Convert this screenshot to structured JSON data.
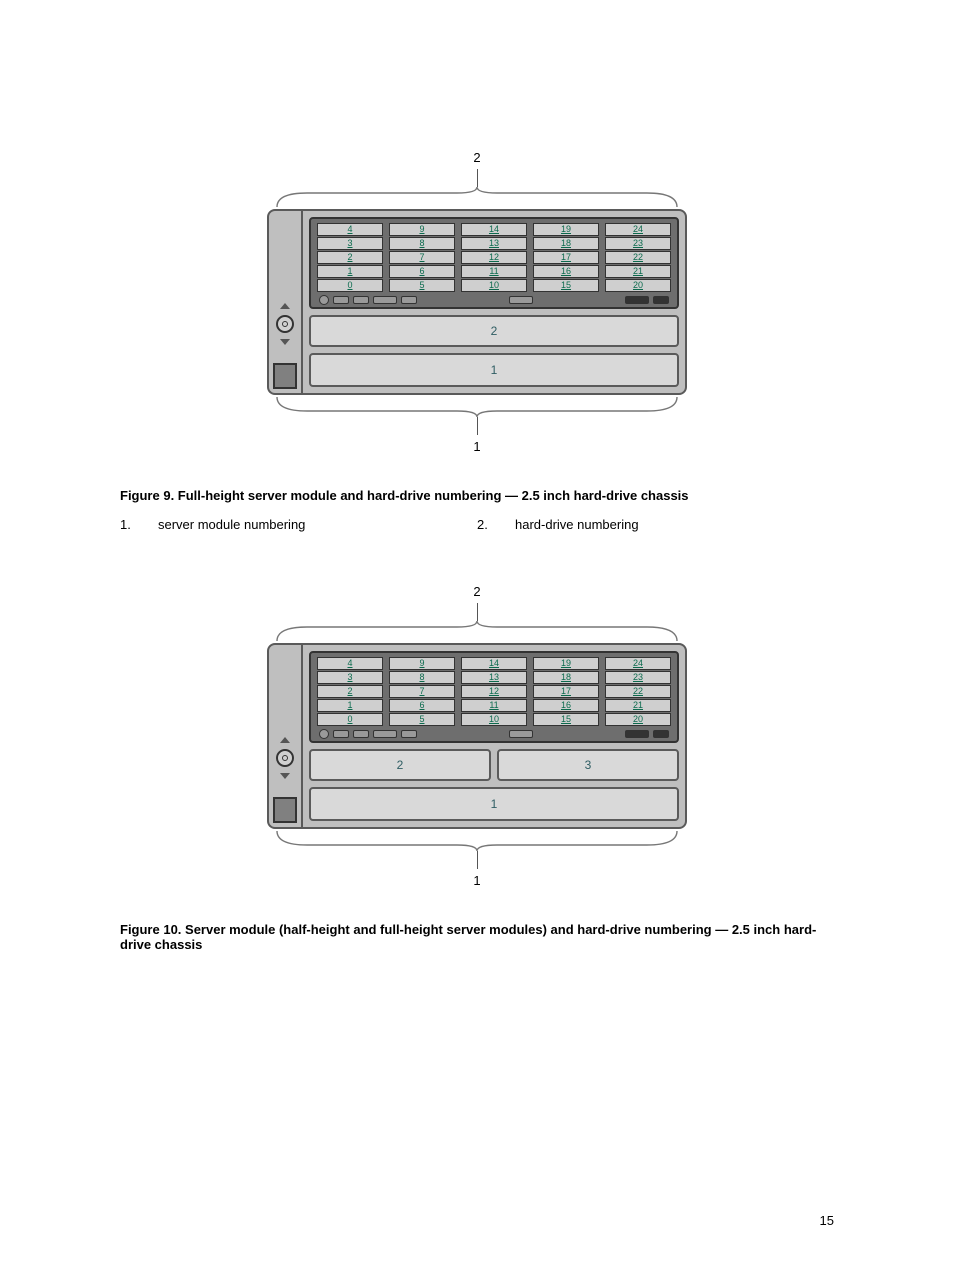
{
  "figure9": {
    "captionPrefix": "Figure 9. ",
    "captionText": "Full-height server module and hard-drive numbering — 2.5 inch hard-drive chassis",
    "calloutTop": "2",
    "calloutBottom": "1",
    "driveColumns": [
      [
        "4",
        "3",
        "2",
        "1",
        "0"
      ],
      [
        "9",
        "8",
        "7",
        "6",
        "5"
      ],
      [
        "14",
        "13",
        "12",
        "11",
        "10"
      ],
      [
        "19",
        "18",
        "17",
        "16",
        "15"
      ],
      [
        "24",
        "23",
        "22",
        "21",
        "20"
      ]
    ],
    "modules": [
      {
        "cells": [
          "2"
        ],
        "tall": false
      },
      {
        "cells": [
          "1"
        ],
        "tall": true
      }
    ],
    "legend": [
      {
        "n": "1.",
        "t": "server module numbering"
      },
      {
        "n": "2.",
        "t": "hard-drive numbering"
      }
    ]
  },
  "figure10": {
    "captionPrefix": "Figure 10. ",
    "captionText": "Server module (half-height and full-height server modules) and hard-drive numbering — 2.5 inch hard-drive chassis",
    "calloutTop": "2",
    "calloutBottom": "1",
    "driveColumns": [
      [
        "4",
        "3",
        "2",
        "1",
        "0"
      ],
      [
        "9",
        "8",
        "7",
        "6",
        "5"
      ],
      [
        "14",
        "13",
        "12",
        "11",
        "10"
      ],
      [
        "19",
        "18",
        "17",
        "16",
        "15"
      ],
      [
        "24",
        "23",
        "22",
        "21",
        "20"
      ]
    ],
    "modules": [
      {
        "cells": [
          "2",
          "3"
        ],
        "tall": false
      },
      {
        "cells": [
          "1"
        ],
        "tall": true
      }
    ]
  },
  "pageNumber": "15"
}
